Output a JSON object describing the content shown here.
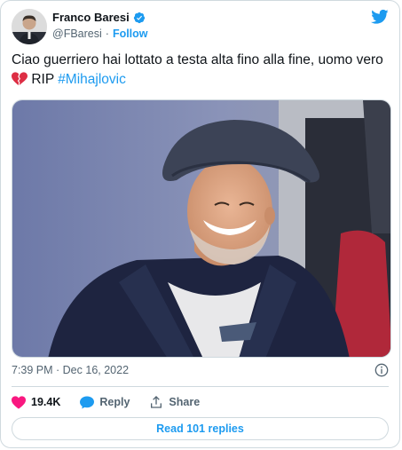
{
  "tweet": {
    "author_name": "Franco Baresi",
    "author_handle": "@FBaresi",
    "separator": "·",
    "follow_label": "Follow",
    "text_main": "Ciao guerriero hai lottato a testa alta fino alla fine, uomo vero",
    "text_rip": "RIP",
    "hashtag": "#Mihajlovic",
    "timestamp": "7:39 PM · Dec 16, 2022",
    "likes_count": "19.4K",
    "reply_label": "Reply",
    "share_label": "Share",
    "read_replies_label": "Read 101 replies"
  },
  "colors": {
    "accent": "#1d9bf0",
    "like": "#f91880",
    "text": "#0f1419",
    "muted": "#536471",
    "border": "#cfd9de"
  },
  "icons": {
    "verified": "verified-badge-icon",
    "logo": "twitter-bird-icon",
    "broken_heart": "broken-heart-emoji",
    "info": "info-icon",
    "like": "heart-icon",
    "reply": "speech-bubble-icon",
    "share": "share-arrow-icon"
  }
}
